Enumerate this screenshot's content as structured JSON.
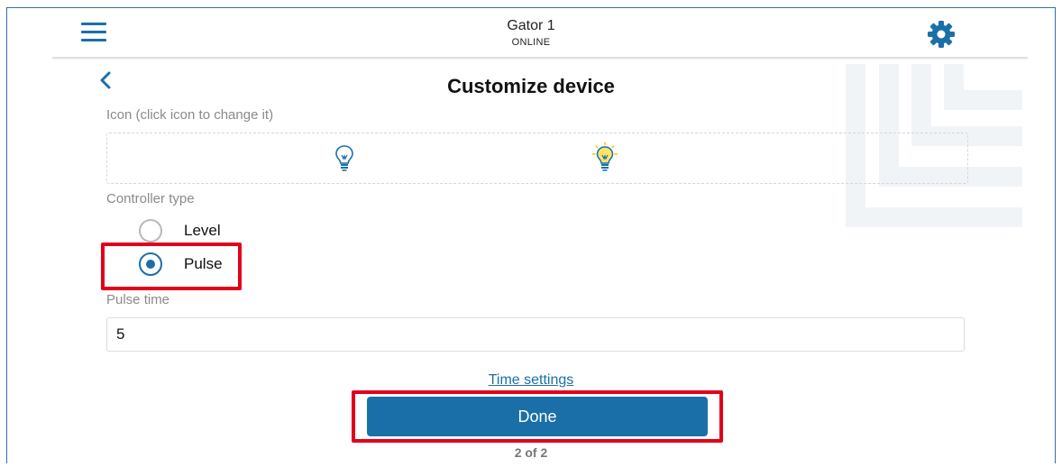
{
  "header": {
    "title": "Gator 1",
    "status": "ONLINE",
    "menu_icon": "hamburger-menu-icon",
    "settings_icon": "gear-icon"
  },
  "page": {
    "back_icon": "chevron-left-icon",
    "title": "Customize device"
  },
  "icon_section": {
    "label": "Icon (click icon to change it)",
    "options": [
      {
        "icon": "lightbulb-off-icon",
        "selected": false
      },
      {
        "icon": "lightbulb-on-icon",
        "selected": true
      }
    ]
  },
  "controller_type": {
    "label": "Controller type",
    "options": [
      {
        "label": "Level",
        "selected": false
      },
      {
        "label": "Pulse",
        "selected": true
      }
    ]
  },
  "pulse_time": {
    "label": "Pulse time",
    "value": "5"
  },
  "time_settings_link": "Time settings",
  "done_button": "Done",
  "pager": "2 of 2",
  "colors": {
    "accent": "#1b6fa8",
    "highlight": "#e3001b",
    "muted_text": "#8a8a8a"
  }
}
